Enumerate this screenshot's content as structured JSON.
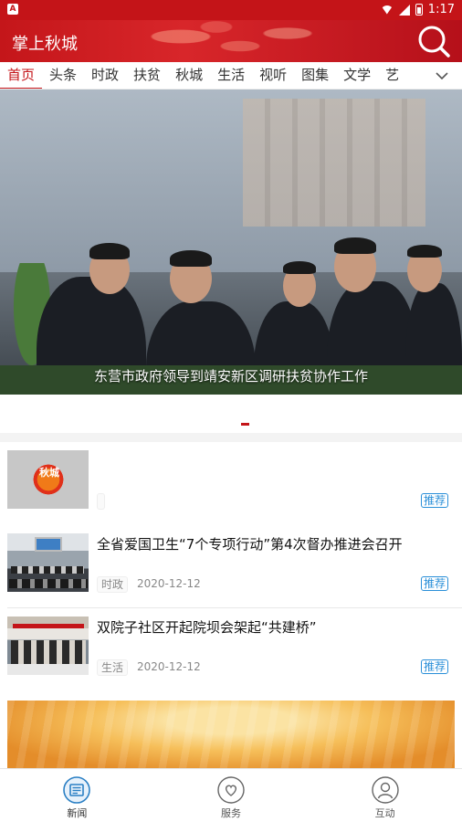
{
  "status_bar": {
    "time": "1:17",
    "notification_badge": "A"
  },
  "header": {
    "title": "掌上秋城"
  },
  "channels": {
    "items": [
      "首页",
      "头条",
      "时政",
      "扶贫",
      "秋城",
      "生活",
      "视听",
      "图集",
      "文学",
      "艺"
    ],
    "active_index": 0
  },
  "banner": {
    "caption": "东营市政府领导到靖安新区调研扶贫协作工作"
  },
  "news": [
    {
      "headline": "",
      "category": "",
      "date": "",
      "tag": "推荐",
      "thumb_text": "秋城"
    },
    {
      "headline": "全省爱国卫生“7个专项行动”第4次督办推进会召开",
      "category": "时政",
      "date": "2020-12-12",
      "tag": "推荐"
    },
    {
      "headline": "双院子社区开起院坝会架起“共建桥”",
      "category": "生活",
      "date": "2020-12-12",
      "tag": "推荐"
    }
  ],
  "bottom_nav": [
    {
      "label": "新闻",
      "icon": "news-icon",
      "active": true
    },
    {
      "label": "服务",
      "icon": "heart-icon",
      "active": false
    },
    {
      "label": "互动",
      "icon": "user-icon",
      "active": false
    }
  ],
  "colors": {
    "brand_red": "#c41418",
    "tag_blue": "#2a8fd8",
    "active_nav_blue": "#2a7fc4"
  }
}
